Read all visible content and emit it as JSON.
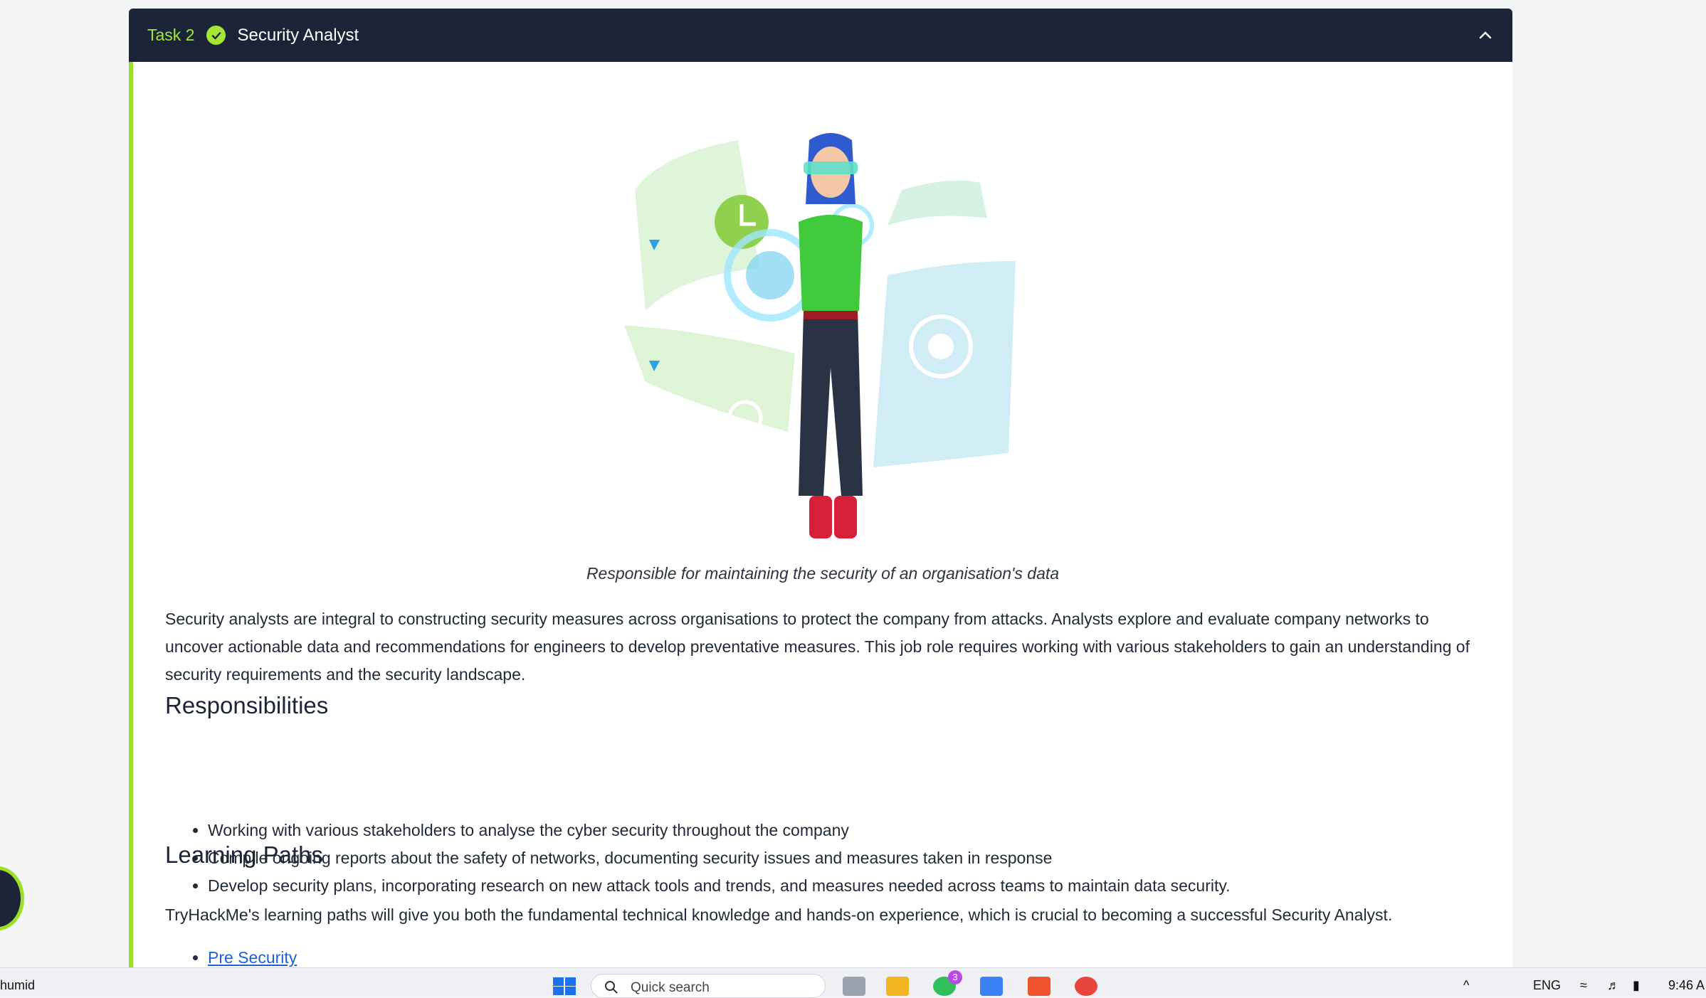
{
  "task": {
    "number_label": "Task 2",
    "title": "Security Analyst"
  },
  "content": {
    "image_caption": "Responsible for maintaining the security of an organisation's data",
    "intro": "Security analysts are integral to constructing security measures across organisations to protect the company from attacks. Analysts explore and evaluate company networks to uncover actionable data and recommendations for engineers to develop preventative measures. This job role requires working with various stakeholders to gain an understanding of security requirements and the security landscape.",
    "responsibilities_heading": "Responsibilities",
    "responsibilities": [
      "Working with various stakeholders to analyse the cyber security throughout the company",
      "Compile ongoing reports about the safety of networks, documenting security issues and measures taken in response",
      "Develop security plans, incorporating research on new attack tools and trends, and measures needed across teams to maintain data security."
    ],
    "learning_heading": "Learning Paths",
    "learning_text": "TryHackMe's learning paths will give you both the fundamental technical knowledge and hands-on experience, which is crucial to becoming a successful Security Analyst.",
    "learning_links": [
      "Pre Security"
    ]
  },
  "taskbar": {
    "left_text": "humid",
    "search_placeholder": "Quick search",
    "notification_count": "3",
    "language": "ENG",
    "time": "9:46 A"
  },
  "colors": {
    "accent": "#a3e635",
    "header_bg": "#1c2538",
    "link": "#1d5fd6"
  }
}
